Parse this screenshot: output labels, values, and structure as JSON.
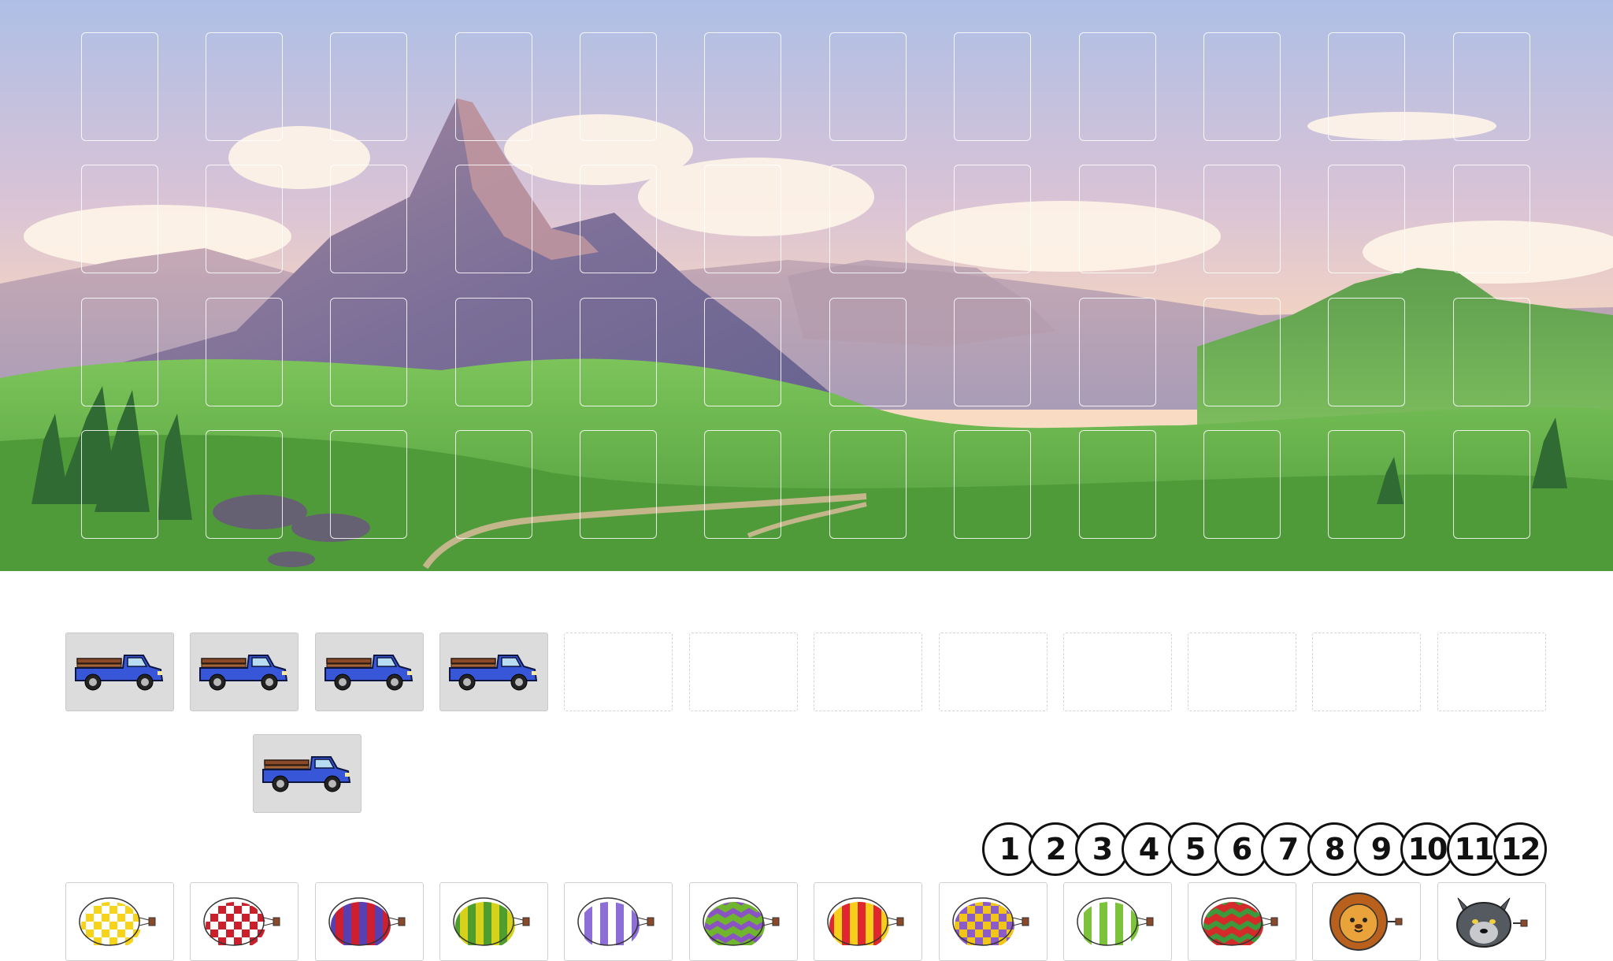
{
  "scene": {
    "name": "mountain-valley-background",
    "slot_rows": 4,
    "slot_cols": 12
  },
  "tray": {
    "filled_count": 4,
    "empty_count": 8,
    "item_icon": "pickup-truck-icon",
    "dragged_item_icon": "pickup-truck-icon"
  },
  "numbers": [
    "1",
    "2",
    "3",
    "4",
    "5",
    "6",
    "7",
    "8",
    "9",
    "10",
    "11",
    "12"
  ],
  "balloons": [
    {
      "icon": "balloon-yellow-checker-icon",
      "a": "#f7d31a",
      "b": "#ffffff",
      "pattern": "checker"
    },
    {
      "icon": "balloon-red-checker-icon",
      "a": "#cc1f2c",
      "b": "#ffffff",
      "pattern": "checker"
    },
    {
      "icon": "balloon-red-purple-stripe-icon",
      "a": "#cc2030",
      "b": "#5a3fb0",
      "pattern": "stripe"
    },
    {
      "icon": "balloon-green-yellow-stripe-icon",
      "a": "#d6d21b",
      "b": "#4f9d2c",
      "pattern": "stripe"
    },
    {
      "icon": "balloon-purple-white-stripe-icon",
      "a": "#8c6ed6",
      "b": "#ffffff",
      "pattern": "stripe"
    },
    {
      "icon": "balloon-green-purple-zigzag-icon",
      "a": "#6fb52d",
      "b": "#8b52c4",
      "pattern": "zigzag"
    },
    {
      "icon": "balloon-red-yellow-stripe-icon",
      "a": "#e0262e",
      "b": "#f7cf1b",
      "pattern": "hstripe"
    },
    {
      "icon": "balloon-yellow-purple-checker-icon",
      "a": "#f2c619",
      "b": "#8b5cc8",
      "pattern": "checker"
    },
    {
      "icon": "balloon-green-white-stripe-icon",
      "a": "#7cc23b",
      "b": "#ffffff",
      "pattern": "stripe"
    },
    {
      "icon": "balloon-red-green-zigzag-icon",
      "a": "#d42a2a",
      "b": "#3c9a3c",
      "pattern": "zigzag"
    },
    {
      "icon": "lion-face-icon",
      "a": "#e9a33a",
      "b": "#b8601c",
      "pattern": "lion"
    },
    {
      "icon": "wolf-face-icon",
      "a": "#555a60",
      "b": "#c7c9cc",
      "pattern": "wolf"
    }
  ]
}
